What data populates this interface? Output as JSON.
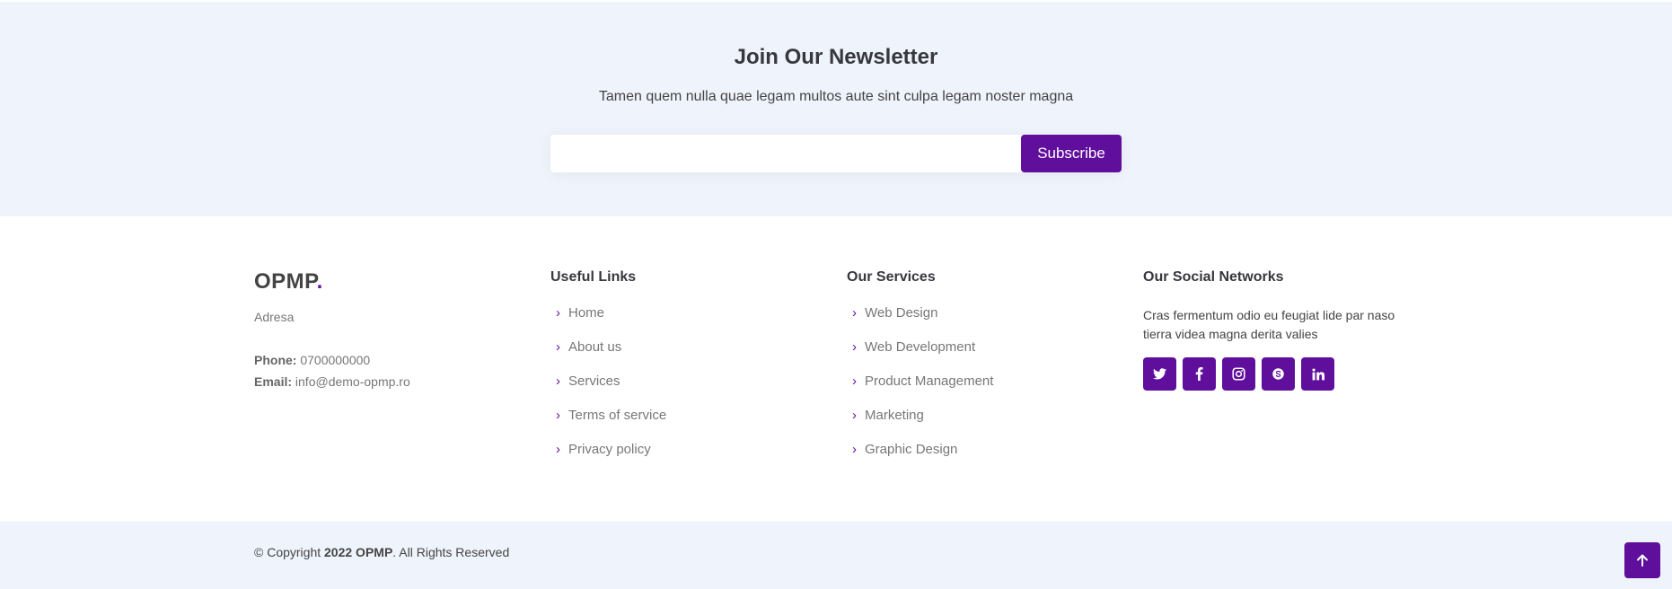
{
  "newsletter": {
    "title": "Join Our Newsletter",
    "subtitle": "Tamen quem nulla quae legam multos aute sint culpa legam noster magna",
    "input_value": "",
    "input_placeholder": "",
    "button_label": "Subscribe"
  },
  "about": {
    "brand": "OPMP",
    "brand_dot": ".",
    "address": "Adresa",
    "phone_label": "Phone:",
    "phone": "0700000000",
    "email_label": "Email:",
    "email": "info@demo-opmp.ro"
  },
  "useful_links": {
    "title": "Useful Links",
    "items": [
      "Home",
      "About us",
      "Services",
      "Terms of service",
      "Privacy policy"
    ]
  },
  "services": {
    "title": "Our Services",
    "items": [
      "Web Design",
      "Web Development",
      "Product Management",
      "Marketing",
      "Graphic Design"
    ]
  },
  "social": {
    "title": "Our Social Networks",
    "text": "Cras fermentum odio eu feugiat lide par naso tierra videa magna derita valies",
    "icons": [
      "twitter-icon",
      "facebook-icon",
      "instagram-icon",
      "skype-icon",
      "linkedin-icon"
    ]
  },
  "footer": {
    "copyright_prefix": "© Copyright ",
    "copyright_strong": "2022 OPMP",
    "copyright_suffix": ". All Rights Reserved"
  },
  "colors": {
    "accent": "#5f0f9c",
    "light_bg": "#eff3fc",
    "text": "#444444",
    "muted": "#777777"
  }
}
